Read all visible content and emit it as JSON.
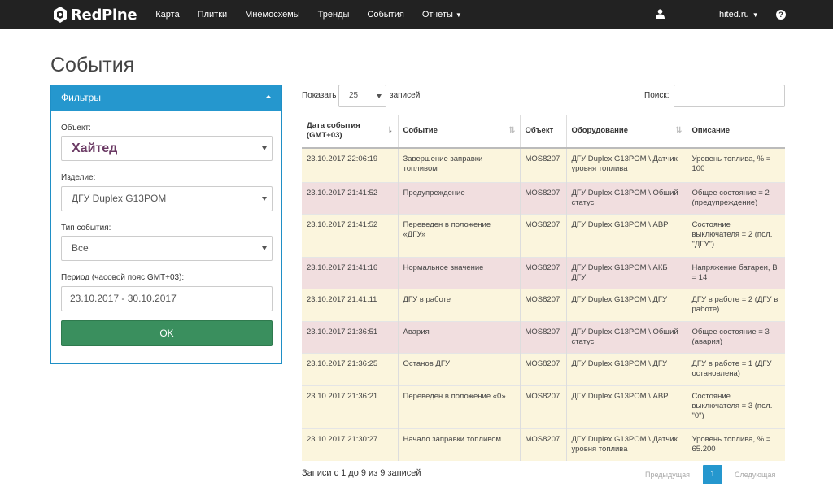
{
  "navbar": {
    "brand": "RedPine",
    "items": [
      "Карта",
      "Плитки",
      "Мнемосхемы",
      "Тренды",
      "События",
      "Отчеты"
    ],
    "user": "hited.ru",
    "help": "?"
  },
  "page": {
    "title": "События"
  },
  "filters": {
    "heading": "Фильтры",
    "object_label": "Объект:",
    "object_value": "Хайтед",
    "product_label": "Изделие:",
    "product_value": "ДГУ Duplex G13POM",
    "event_type_label": "Тип события:",
    "event_type_value": "Все",
    "period_label": "Период (часовой пояс GMT+03):",
    "period_value": "23.10.2017 - 30.10.2017",
    "ok_label": "OK"
  },
  "table_controls": {
    "show_label": "Показать",
    "length_value": "25",
    "records_label": "записей",
    "search_label": "Поиск:"
  },
  "table": {
    "headers": [
      "Дата события (GMT+03)",
      "Событие",
      "Объект",
      "Оборудование",
      "Описание"
    ],
    "rows": [
      {
        "date": "23.10.2017 22:06:19",
        "event": "Завершение заправки топливом",
        "object": "MOS8207",
        "equipment": "ДГУ Duplex G13POM \\ Датчик уровня топлива",
        "description": "Уровень топлива, % = 100",
        "status": "warn"
      },
      {
        "date": "23.10.2017 21:41:52",
        "event": "Предупреждение",
        "object": "MOS8207",
        "equipment": "ДГУ Duplex G13POM \\ Общий статус",
        "description": "Общее состояние = 2 (предупреждение)",
        "status": "alert"
      },
      {
        "date": "23.10.2017 21:41:52",
        "event": "Переведен в положение «ДГУ»",
        "object": "MOS8207",
        "equipment": "ДГУ Duplex G13POM \\ АВР",
        "description": "Состояние выключателя = 2 (пол. \"ДГУ\")",
        "status": "warn"
      },
      {
        "date": "23.10.2017 21:41:16",
        "event": "Нормальное значение",
        "object": "MOS8207",
        "equipment": "ДГУ Duplex G13POM \\ АКБ ДГУ",
        "description": "Напряжение батареи, В = 14",
        "status": "alert"
      },
      {
        "date": "23.10.2017 21:41:11",
        "event": "ДГУ в работе",
        "object": "MOS8207",
        "equipment": "ДГУ Duplex G13POM \\ ДГУ",
        "description": "ДГУ в работе = 2 (ДГУ в работе)",
        "status": "warn"
      },
      {
        "date": "23.10.2017 21:36:51",
        "event": "Авария",
        "object": "MOS8207",
        "equipment": "ДГУ Duplex G13POM \\ Общий статус",
        "description": "Общее состояние = 3 (авария)",
        "status": "alert"
      },
      {
        "date": "23.10.2017 21:36:25",
        "event": "Останов ДГУ",
        "object": "MOS8207",
        "equipment": "ДГУ Duplex G13POM \\ ДГУ",
        "description": "ДГУ в работе = 1 (ДГУ остановлена)",
        "status": "warn"
      },
      {
        "date": "23.10.2017 21:36:21",
        "event": "Переведен в положение «0»",
        "object": "MOS8207",
        "equipment": "ДГУ Duplex G13POM \\ АВР",
        "description": "Состояние выключателя = 3 (пол. \"0\")",
        "status": "warn"
      },
      {
        "date": "23.10.2017 21:30:27",
        "event": "Начало заправки топливом",
        "object": "MOS8207",
        "equipment": "ДГУ Duplex G13POM \\ Датчик уровня топлива",
        "description": "Уровень топлива, % = 65.200",
        "status": "warn"
      }
    ]
  },
  "footer": {
    "info": "Записи с 1 до 9 из 9 записей",
    "prev": "Предыдущая",
    "current": "1",
    "next": "Следующая"
  }
}
